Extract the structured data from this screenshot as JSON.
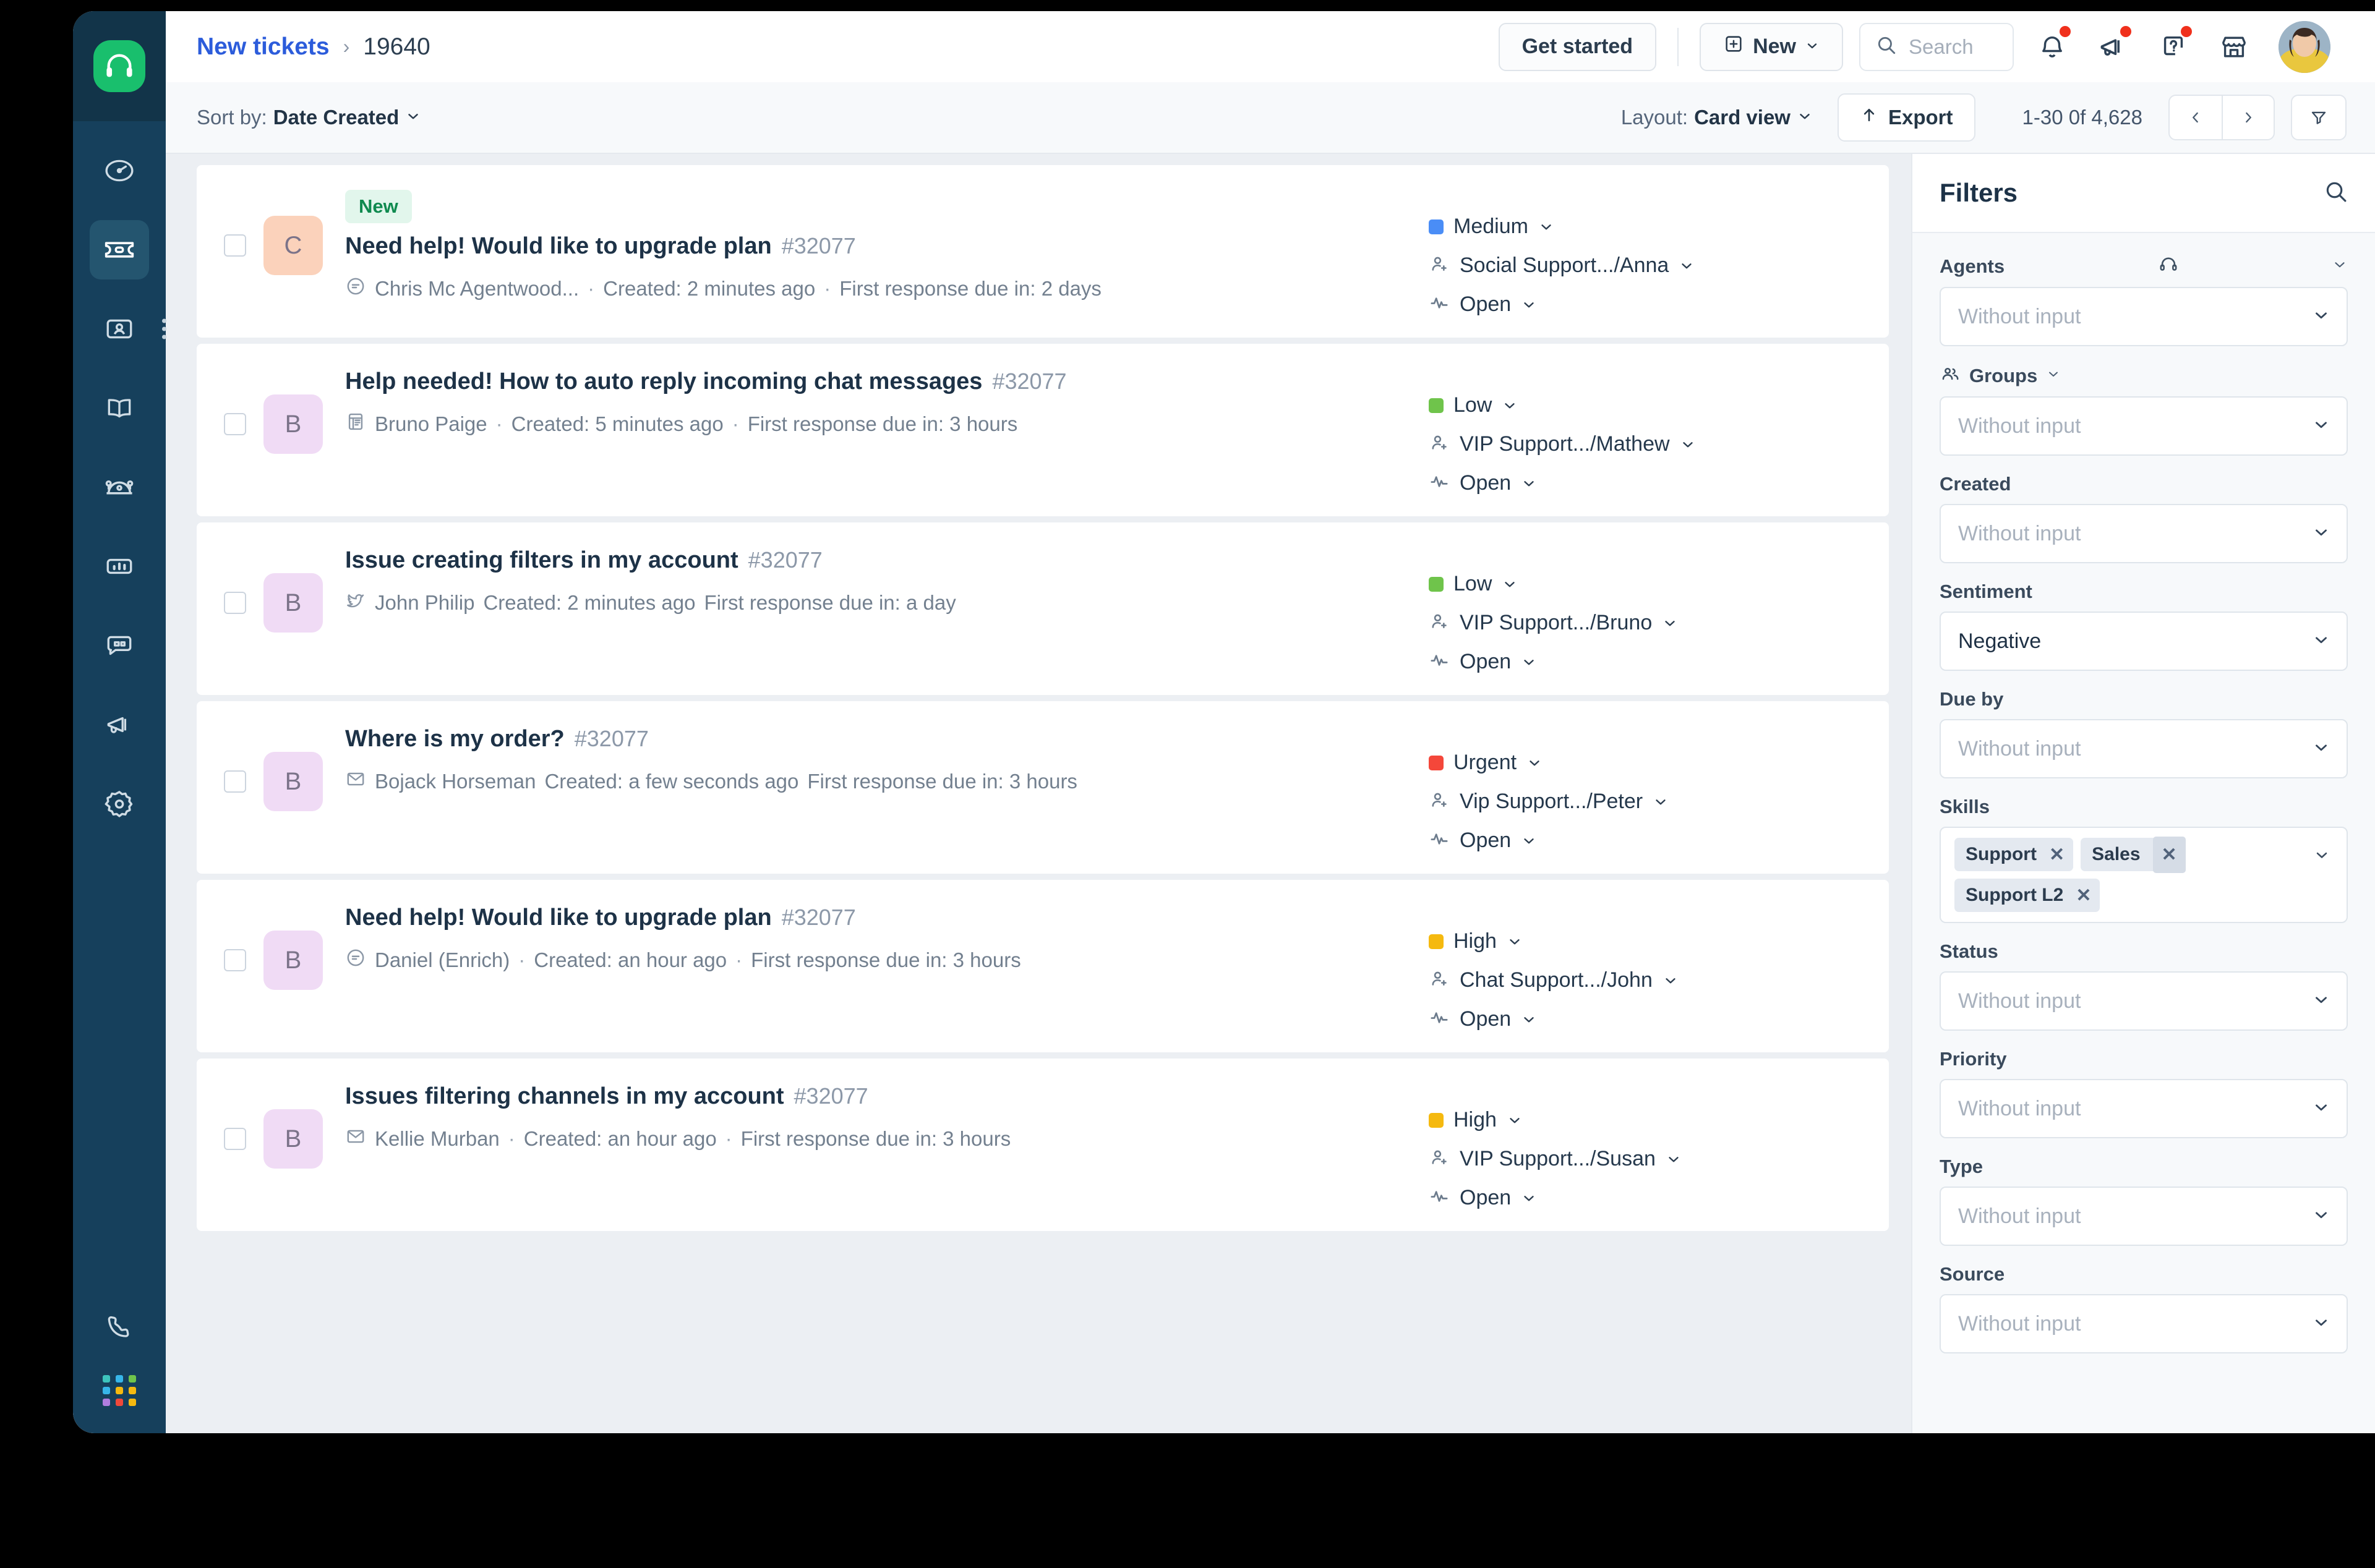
{
  "window": {
    "background_color": "#000000",
    "surface_color": "#eceff3"
  },
  "sidebar": {
    "logo_icon": "headset-logo-icon",
    "logo_color": "#19bf6d",
    "background_color": "#16405c",
    "items": [
      {
        "icon": "dashboard-speedometer-icon",
        "name": "dashboard",
        "active": false
      },
      {
        "icon": "ticket-icon",
        "name": "tickets",
        "active": true
      },
      {
        "icon": "contacts-icon",
        "name": "contacts",
        "active": false,
        "has_overflow_dots": true
      },
      {
        "icon": "knowledge-base-book-icon",
        "name": "knowledge-base",
        "active": false
      },
      {
        "icon": "automations-icon",
        "name": "automations",
        "active": false
      },
      {
        "icon": "reports-bar-chart-icon",
        "name": "reports",
        "active": false
      },
      {
        "icon": "chat-bubble-icon",
        "name": "chat",
        "active": false
      },
      {
        "icon": "megaphone-icon",
        "name": "announcements",
        "active": false
      },
      {
        "icon": "gear-icon",
        "name": "settings",
        "active": false
      }
    ],
    "bottom_items": [
      {
        "icon": "phone-icon",
        "name": "phone"
      },
      {
        "icon": "app-switcher-grid-icon",
        "name": "app-switcher"
      }
    ]
  },
  "header": {
    "breadcrumb": {
      "root": "New tickets",
      "separator": "›",
      "current": "19640"
    },
    "get_started_label": "Get started",
    "new_button_label": "New",
    "new_button_icon": "plus-square-icon",
    "search_placeholder": "Search",
    "search_icon": "search-icon",
    "icons": [
      {
        "name": "bell-notification-icon",
        "badge": true
      },
      {
        "name": "megaphone-announcement-icon",
        "badge": true
      },
      {
        "name": "help-question-icon",
        "badge": true
      },
      {
        "name": "marketplace-store-icon",
        "badge": false
      }
    ],
    "avatar_name": "user-avatar",
    "accent_color": "#2c5cdb",
    "badge_color": "#f0301c"
  },
  "toolbar": {
    "sort_prefix": "Sort by:",
    "sort_value": "Date Created",
    "layout_prefix": "Layout:",
    "layout_value": "Card view",
    "export_label": "Export",
    "export_icon": "upload-arrow-icon",
    "pagination": "1-30 0f 4,628",
    "prev_icon": "chevron-left-icon",
    "next_icon": "chevron-right-icon",
    "filter_icon": "funnel-filter-icon"
  },
  "tickets": [
    {
      "badge": "New",
      "avatar_letter": "C",
      "avatar_color": "#fbd2bb",
      "title": "Need help! Would like to upgrade plan",
      "id": "#32077",
      "channel_icon": "chat-bubble-icon",
      "requester": "Chris Mc Agentwood...",
      "created": "Created: 2 minutes ago",
      "sla": "First response due in: 2 days",
      "meta_separator": "·",
      "priority": "Medium",
      "priority_color": "#4a8df6",
      "assignee": "Social Support.../Anna",
      "status": "Open"
    },
    {
      "badge": "",
      "avatar_letter": "B",
      "avatar_color": "#f0dbf5",
      "title": "Help needed! How to auto reply incoming chat messages",
      "id": "#32077",
      "channel_icon": "portal-widget-icon",
      "requester": "Bruno Paige",
      "created": "Created: 5 minutes ago",
      "sla": "First response due in: 3 hours",
      "meta_separator": "·",
      "priority": "Low",
      "priority_color": "#6fc44b",
      "assignee": "VIP Support.../Mathew",
      "status": "Open"
    },
    {
      "badge": "",
      "avatar_letter": "B",
      "avatar_color": "#f0dbf5",
      "title": "Issue creating filters in my account",
      "id": "#32077",
      "channel_icon": "twitter-bird-icon",
      "requester": "John Philip",
      "created": "Created: 2 minutes ago",
      "sla": "First response due in: a day",
      "meta_separator": "",
      "priority": "Low",
      "priority_color": "#6fc44b",
      "assignee": "VIP Support.../Bruno",
      "status": "Open"
    },
    {
      "badge": "",
      "avatar_letter": "B",
      "avatar_color": "#f0dbf5",
      "title": "Where is my order?",
      "id": "#32077",
      "channel_icon": "email-envelope-icon",
      "requester": "Bojack Horseman",
      "created": "Created: a few seconds ago",
      "sla": "First response due in: 3 hours",
      "meta_separator": "",
      "priority": "Urgent",
      "priority_color": "#f4473a",
      "assignee": "Vip Support.../Peter",
      "status": "Open"
    },
    {
      "badge": "",
      "avatar_letter": "B",
      "avatar_color": "#f0dbf5",
      "title": "Need help! Would like to upgrade plan",
      "id": "#32077",
      "channel_icon": "chat-bubble-icon",
      "requester": "Daniel (Enrich)",
      "created": "Created: an hour ago",
      "sla": "First response due in: 3 hours",
      "meta_separator": "·",
      "priority": "High",
      "priority_color": "#f5b90f",
      "assignee": "Chat Support.../John",
      "status": "Open"
    },
    {
      "badge": "",
      "avatar_letter": "B",
      "avatar_color": "#f0dbf5",
      "title": "Issues filtering channels in my account",
      "id": "#32077",
      "channel_icon": "email-envelope-icon",
      "requester": "Kellie Murban",
      "created": "Created: an hour ago",
      "sla": "First response due in: 3 hours",
      "meta_separator": "·",
      "priority": "High",
      "priority_color": "#f5b90f",
      "assignee": "VIP Support.../Susan",
      "status": "Open"
    }
  ],
  "filters": {
    "title": "Filters",
    "search_icon": "search-icon",
    "groups": [
      {
        "label": "Agents",
        "icon": "headset-icon",
        "has_collapse_chevron": true,
        "value": "Without input",
        "is_placeholder": true
      },
      {
        "label": "Groups",
        "icon": "people-group-icon",
        "has_inline_chevron": true,
        "value": "Without input",
        "is_placeholder": true
      },
      {
        "label": "Created",
        "icon": "",
        "value": "Without input",
        "is_placeholder": true
      },
      {
        "label": "Sentiment",
        "icon": "",
        "value": "Negative",
        "is_placeholder": false
      },
      {
        "label": "Due by",
        "icon": "",
        "value": "Without input",
        "is_placeholder": true
      },
      {
        "label": "Skills",
        "icon": "",
        "chips": [
          "Support",
          "Sales",
          "Support L2"
        ],
        "highlighted_chip_index": 1
      },
      {
        "label": "Status",
        "icon": "",
        "value": "Without input",
        "is_placeholder": true
      },
      {
        "label": "Priority",
        "icon": "",
        "value": "Without input",
        "is_placeholder": true
      },
      {
        "label": "Type",
        "icon": "",
        "value": "Without input",
        "is_placeholder": true
      },
      {
        "label": "Source",
        "icon": "",
        "value": "Without input",
        "is_placeholder": true
      }
    ]
  }
}
